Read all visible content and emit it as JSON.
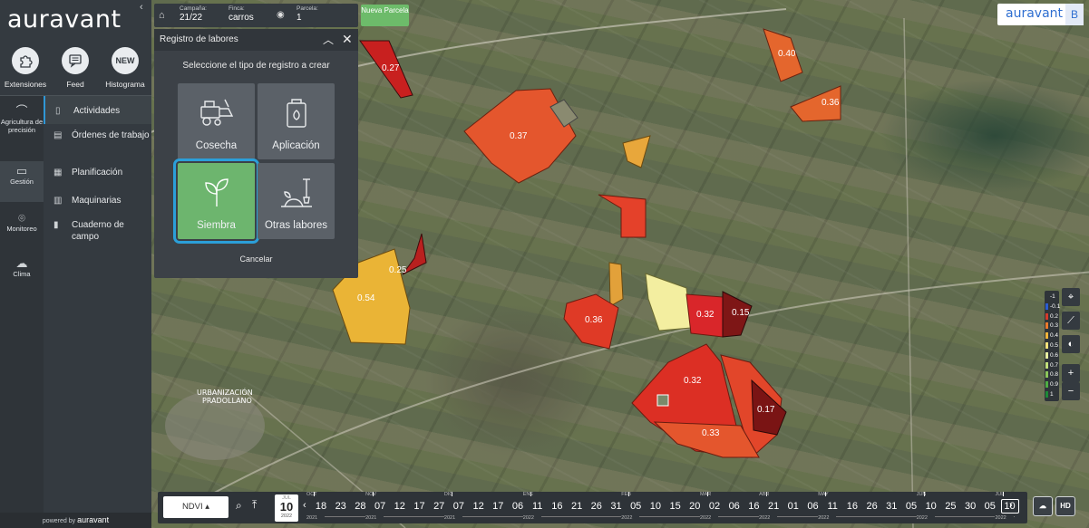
{
  "app": {
    "logo": "auravant",
    "powered_by": "powered by",
    "powered_brand": "auravant"
  },
  "top_actions": [
    {
      "label": "Extensiones",
      "icon": "puzzle-icon"
    },
    {
      "label": "Feed",
      "icon": "chat-icon"
    },
    {
      "label": "Histograma",
      "icon": "new-badge-icon",
      "badge": "NEW"
    }
  ],
  "rail": [
    {
      "label": "Agricultura de precisión",
      "icon": "wave-icon"
    },
    {
      "label": "Gestión",
      "icon": "clipboard-icon",
      "active": true
    },
    {
      "label": "Monitoreo",
      "icon": "location-icon"
    },
    {
      "label": "Clima",
      "icon": "cloud-icon"
    }
  ],
  "menu": [
    {
      "label": "Actividades",
      "icon": "clipboard-icon",
      "active": true
    },
    {
      "label": "Órdenes de trabajo",
      "icon": "doc-icon"
    },
    {
      "label": "Planificación",
      "icon": "calendar-icon"
    },
    {
      "label": "Maquinarias",
      "icon": "tractor-icon"
    },
    {
      "label": "Cuaderno de campo",
      "icon": "notebook-icon"
    }
  ],
  "topbar": {
    "campaign_label": "Campaña:",
    "campaign_value": "21/22",
    "farm_label": "Finca:",
    "farm_value": "carros",
    "parcel_label": "Parcela:",
    "parcel_value": "1",
    "new_parcel": "Nueva Parcela"
  },
  "brand_badge": {
    "text": "auravant",
    "user_initial": "B"
  },
  "modal": {
    "title": "Registro de labores",
    "subtitle": "Seleccione el tipo de registro a crear",
    "options": [
      "Cosecha",
      "Aplicación",
      "Siembra",
      "Otras labores"
    ],
    "selected": "Siembra",
    "cancel": "Cancelar"
  },
  "map": {
    "labels": [
      "0.27",
      "0.40",
      "0.36",
      "0.37",
      "0.25",
      "0.54",
      "0.36",
      "0.32",
      "0.15",
      "0.32",
      "0.17",
      "0.33"
    ],
    "place_name_line1": "URBANIZACIÓN",
    "place_name_line2": "PRADOLLANO"
  },
  "legend": {
    "values": [
      "-1",
      "-0.1",
      "0.2",
      "0.3",
      "0.4",
      "0.5",
      "0.6",
      "0.7",
      "0.8",
      "0.9",
      "1"
    ],
    "colors": [
      "#2f3439",
      "#2a5cd1",
      "#d43a2a",
      "#ea7a2b",
      "#f0b43a",
      "#f6e27a",
      "#e8f0a0",
      "#c2e07a",
      "#8cc75a",
      "#4fae43",
      "#1d8a36"
    ]
  },
  "tools": [
    "pin-icon",
    "ruler-icon",
    "compass-icon",
    "zoom-in-icon",
    "zoom-out-icon"
  ],
  "timeline": {
    "index": "NDVI",
    "selected_date": {
      "month": "JUL",
      "day": "10",
      "year": "2022"
    },
    "days": [
      "18",
      "23",
      "28",
      "07",
      "12",
      "17",
      "27",
      "07",
      "12",
      "17",
      "06",
      "11",
      "16",
      "21",
      "26",
      "31",
      "05",
      "10",
      "15",
      "20",
      "02",
      "06",
      "16",
      "21",
      "01",
      "06",
      "11",
      "16",
      "26",
      "31",
      "05",
      "10",
      "25",
      "30",
      "05",
      "10"
    ],
    "months": [
      "OCT",
      "NOV",
      "DIC",
      "ENE",
      "FEB",
      "MAR",
      "ABR",
      "MAY",
      "JUN",
      "JUL"
    ],
    "years": [
      "2021",
      "2021",
      "2021",
      "2022",
      "2022",
      "2022",
      "2022",
      "2022",
      "2022",
      "2022"
    ],
    "hd_label": "HD"
  }
}
